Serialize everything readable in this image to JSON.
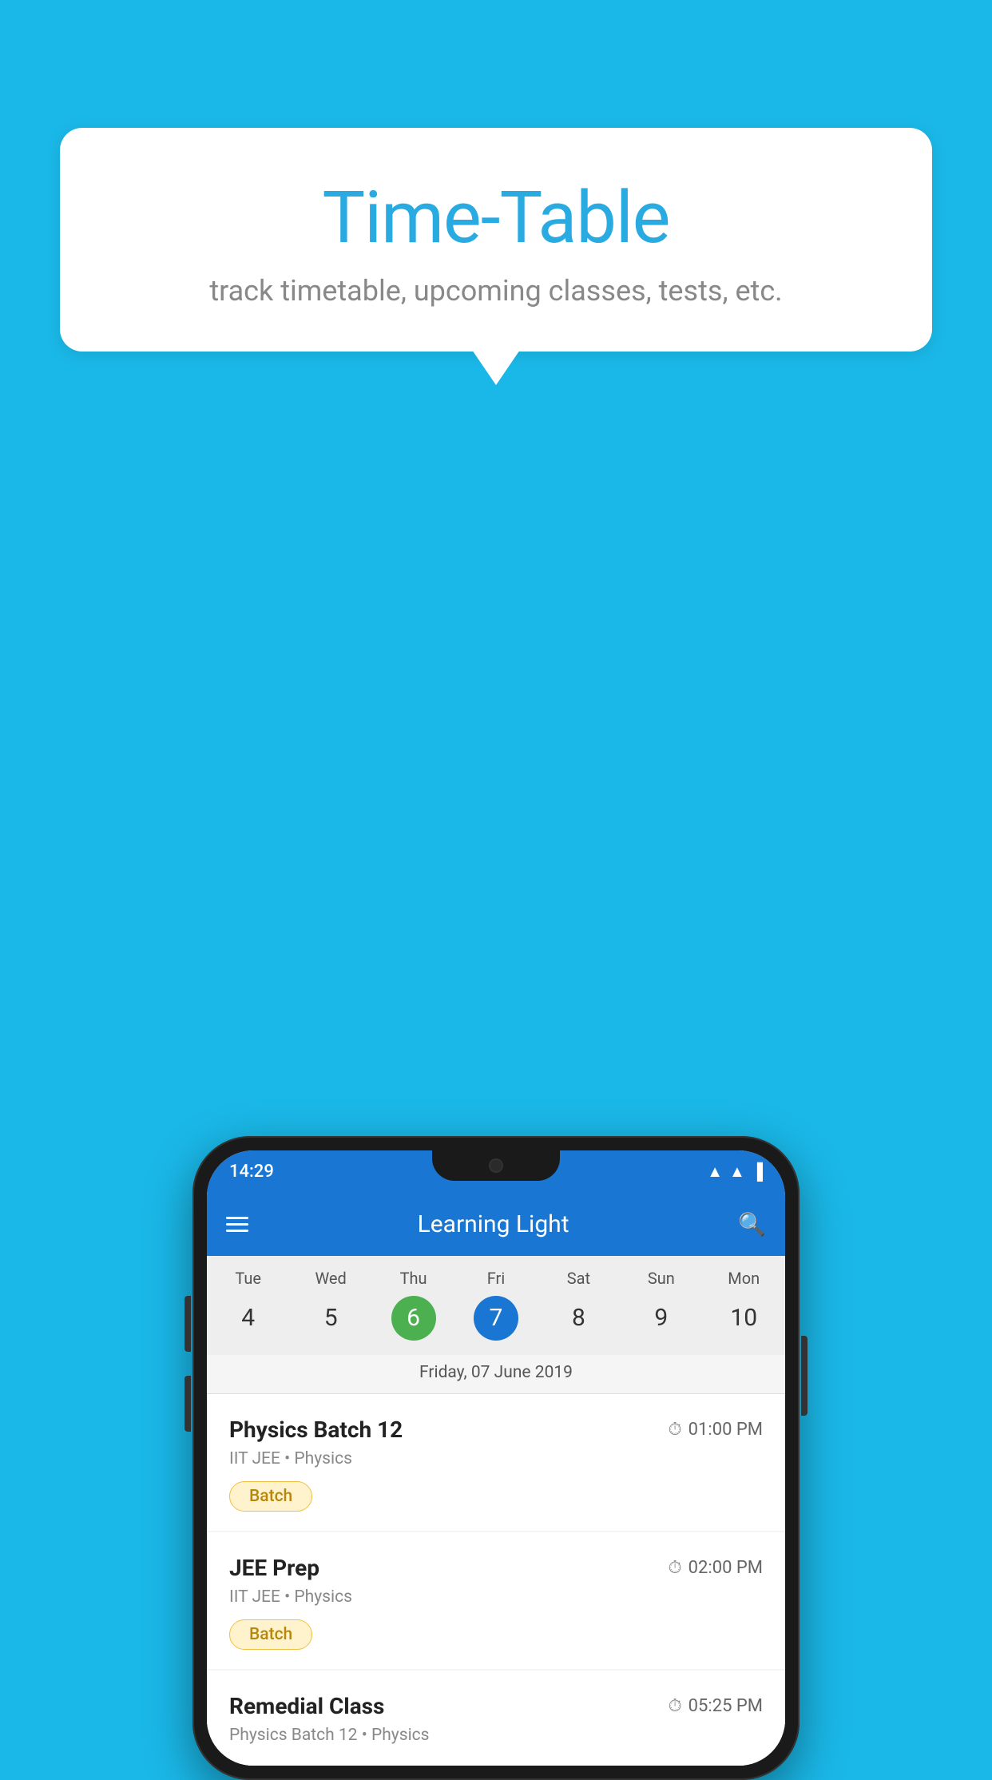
{
  "background_color": "#1ab8e8",
  "speech_bubble": {
    "title": "Time-Table",
    "subtitle": "track timetable, upcoming classes, tests, etc."
  },
  "phone": {
    "status_bar": {
      "time": "14:29"
    },
    "app_bar": {
      "title": "Learning Light"
    },
    "calendar": {
      "days": [
        {
          "label": "Tue",
          "num": "4"
        },
        {
          "label": "Wed",
          "num": "5"
        },
        {
          "label": "Thu",
          "num": "6",
          "style": "green"
        },
        {
          "label": "Fri",
          "num": "7",
          "style": "blue"
        },
        {
          "label": "Sat",
          "num": "8"
        },
        {
          "label": "Sun",
          "num": "9"
        },
        {
          "label": "Mon",
          "num": "10"
        }
      ],
      "selected_date": "Friday, 07 June 2019"
    },
    "classes": [
      {
        "name": "Physics Batch 12",
        "time": "01:00 PM",
        "subtitle": "IIT JEE • Physics",
        "badge": "Batch"
      },
      {
        "name": "JEE Prep",
        "time": "02:00 PM",
        "subtitle": "IIT JEE • Physics",
        "badge": "Batch"
      },
      {
        "name": "Remedial Class",
        "time": "05:25 PM",
        "subtitle": "Physics Batch 12 • Physics",
        "badge": null
      }
    ]
  }
}
